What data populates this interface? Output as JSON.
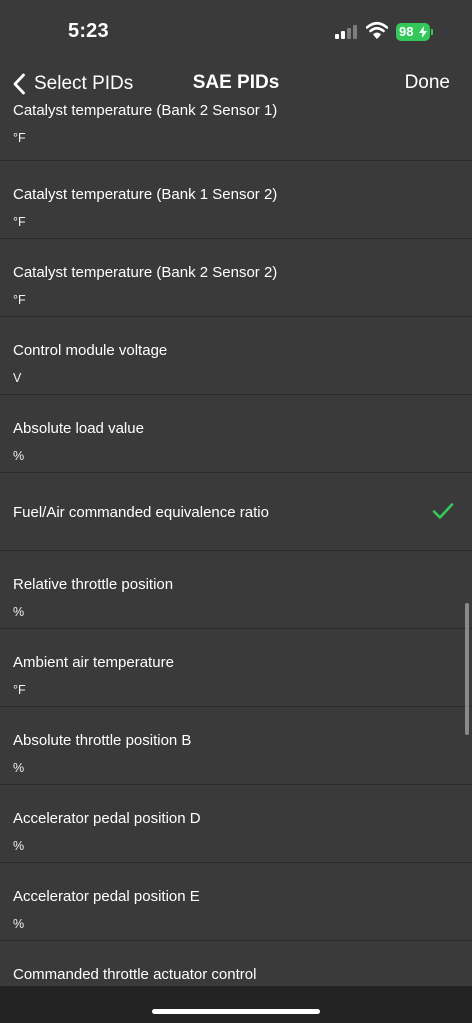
{
  "status_bar": {
    "time": "5:23",
    "battery": "98",
    "signal_icon": "cellular-signal-icon",
    "wifi_icon": "wifi-icon",
    "battery_color": "#34c759"
  },
  "nav": {
    "back_label": "Select PIDs",
    "title": "SAE PIDs",
    "done_label": "Done",
    "back_icon": "chevron-left-icon"
  },
  "pids": [
    {
      "name": "Catalyst temperature (Bank 2 Sensor 1)",
      "unit": "°F",
      "selected": false
    },
    {
      "name": "Catalyst temperature (Bank 1 Sensor 2)",
      "unit": "°F",
      "selected": false
    },
    {
      "name": "Catalyst temperature (Bank 2 Sensor 2)",
      "unit": "°F",
      "selected": false
    },
    {
      "name": "Control module voltage",
      "unit": "V",
      "selected": false
    },
    {
      "name": "Absolute load value",
      "unit": "%",
      "selected": false
    },
    {
      "name": "Fuel/Air commanded equivalence ratio",
      "unit": "",
      "selected": true
    },
    {
      "name": "Relative throttle position",
      "unit": "%",
      "selected": false
    },
    {
      "name": "Ambient air temperature",
      "unit": "°F",
      "selected": false
    },
    {
      "name": "Absolute throttle position B",
      "unit": "%",
      "selected": false
    },
    {
      "name": "Accelerator pedal position D",
      "unit": "%",
      "selected": false
    },
    {
      "name": "Accelerator pedal position E",
      "unit": "%",
      "selected": false
    },
    {
      "name": "Commanded throttle actuator control",
      "unit": "",
      "selected": false
    }
  ],
  "colors": {
    "background": "#3a3a3a",
    "checkmark": "#34c759",
    "separator": "#2b2b2b"
  }
}
